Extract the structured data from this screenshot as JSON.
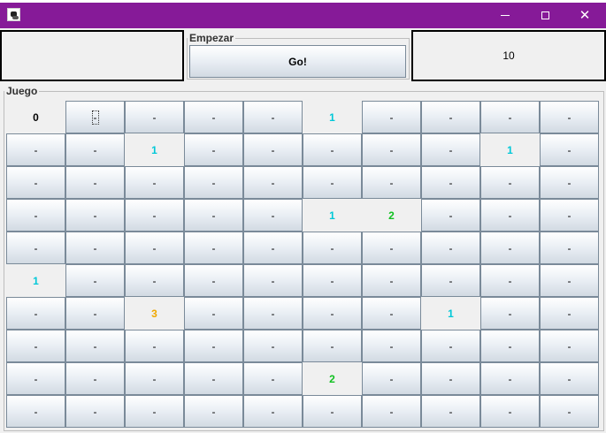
{
  "window": {
    "icon": "minesweeper-app-icon",
    "title": ""
  },
  "controls": {
    "minimize": "minimize-icon",
    "maximize": "maximize-icon",
    "close": "close-icon"
  },
  "top": {
    "left_panel": "",
    "empezar": {
      "legend": "Empezar",
      "go_label": "Go!"
    },
    "counter": "10"
  },
  "game": {
    "legend": "Juego",
    "colors": {
      "1": "#00c8d8",
      "2": "#10c020",
      "3": "#f0a800",
      "0": "#000000"
    },
    "grid": [
      [
        "0",
        "-",
        "-",
        "-",
        "-",
        "1",
        "-",
        "-",
        "-",
        "-"
      ],
      [
        "-",
        "-",
        "1",
        "-",
        "-",
        "-",
        "-",
        "-",
        "1",
        "-"
      ],
      [
        "-",
        "-",
        "-",
        "-",
        "-",
        "-",
        "-",
        "-",
        "-",
        "-"
      ],
      [
        "-",
        "-",
        "-",
        "-",
        "-",
        "1",
        "2",
        "-",
        "-",
        "-"
      ],
      [
        "-",
        "-",
        "-",
        "-",
        "-",
        "-",
        "-",
        "-",
        "-",
        "-"
      ],
      [
        "1",
        "-",
        "-",
        "-",
        "-",
        "-",
        "-",
        "-",
        "-",
        "-"
      ],
      [
        "-",
        "-",
        "3",
        "-",
        "-",
        "-",
        "-",
        "1",
        "-",
        "-"
      ],
      [
        "-",
        "-",
        "-",
        "-",
        "-",
        "-",
        "-",
        "-",
        "-",
        "-"
      ],
      [
        "-",
        "-",
        "-",
        "-",
        "-",
        "2",
        "-",
        "-",
        "-",
        "-"
      ],
      [
        "-",
        "-",
        "-",
        "-",
        "-",
        "-",
        "-",
        "-",
        "-",
        "-"
      ]
    ]
  }
}
